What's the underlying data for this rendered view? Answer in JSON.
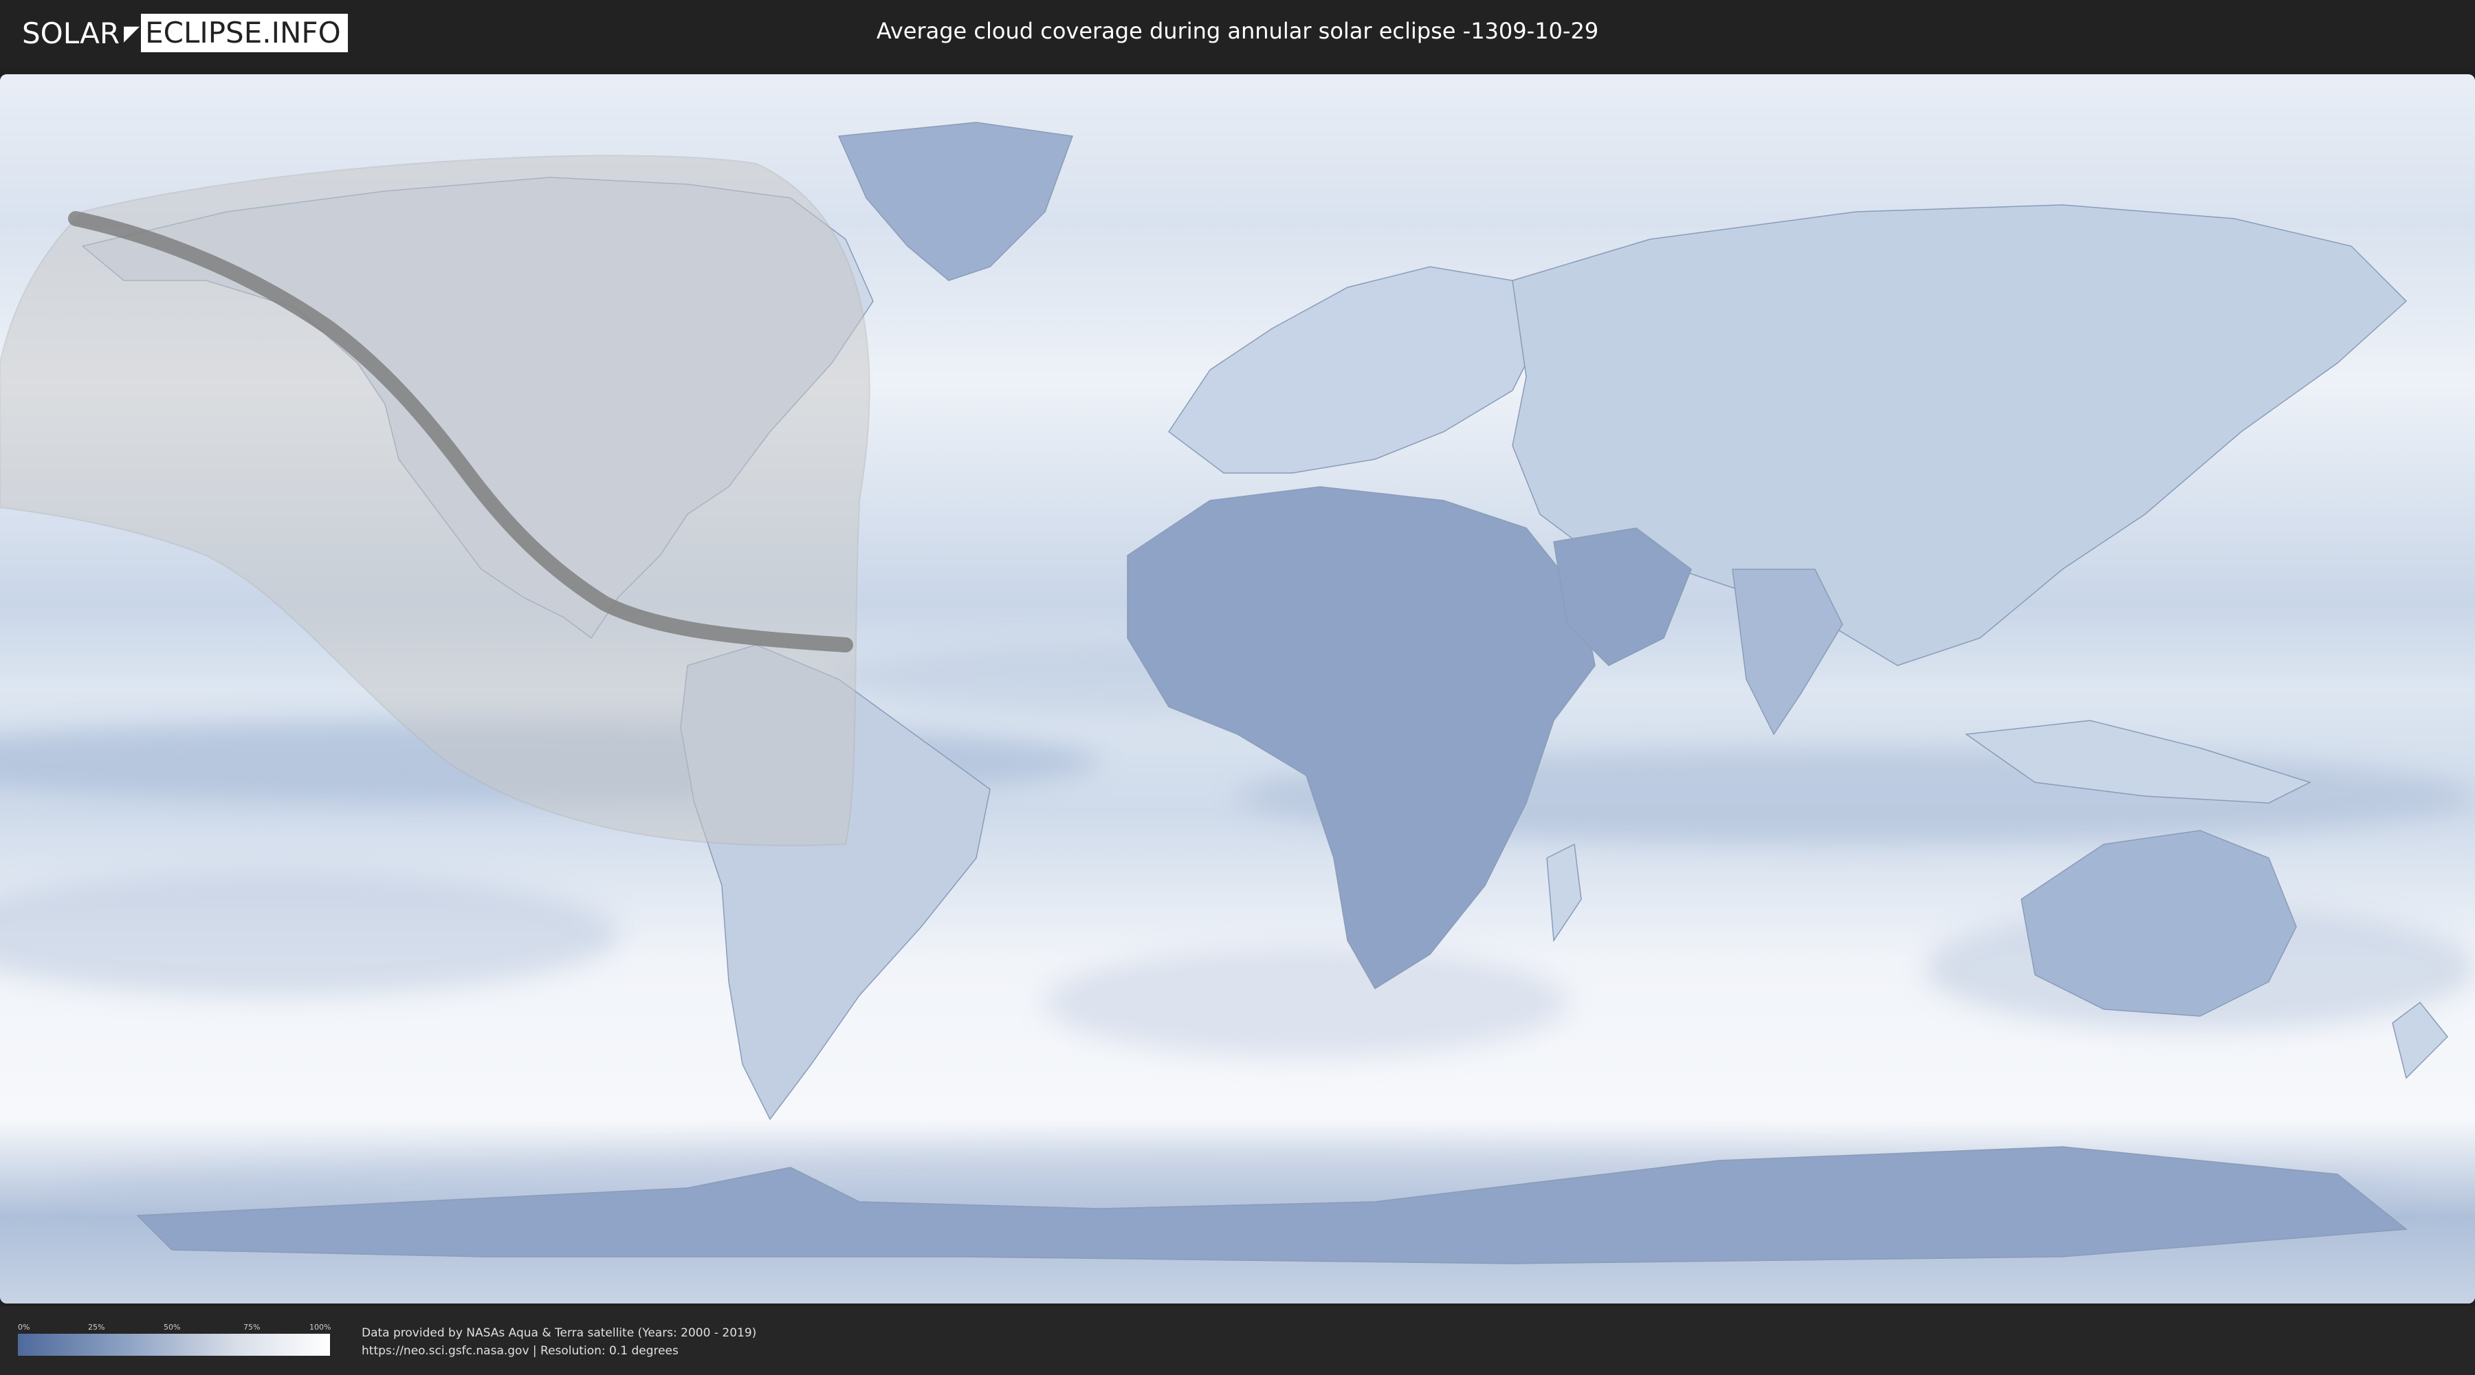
{
  "header": {
    "logo_left": "SOLAR",
    "logo_right": "ECLIPSE.INFO",
    "title": "Average cloud coverage during annular solar eclipse -1309-10-29"
  },
  "legend": {
    "ticks": [
      "0%",
      "25%",
      "50%",
      "75%",
      "100%"
    ],
    "gradient_colors": [
      "#4e6a9c",
      "#8ea3c4",
      "#d8dee8",
      "#ffffff"
    ]
  },
  "credits": {
    "line1": "Data provided by NASAs Aqua & Terra satellite (Years: 2000 - 2019)",
    "line2": "https://neo.sci.gsfc.nasa.gov | Resolution: 0.1 degrees"
  },
  "map": {
    "ocean_color": "#dfe8f2",
    "cloud_color_low": "#6f88b3",
    "eclipse_shadow_color": "#c8c8c8",
    "eclipse_path_color": "#7a7a7a"
  }
}
